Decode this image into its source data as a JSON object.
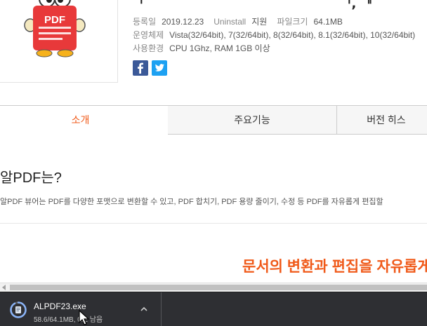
{
  "header": {
    "title_fragment_left": "ᅵ",
    "title_fragment_right": "ᅵ, ᅵᅵ"
  },
  "logo": {
    "text": "PDF"
  },
  "info": {
    "date_key": "등록일",
    "date_value": "2019.12.23",
    "uninstall_key": "Uninstall",
    "uninstall_value": "지원",
    "size_key": "파일크기",
    "size_value": "64.1MB",
    "os_key": "운영체제",
    "os_value": "Vista(32/64bit), 7(32/64bit), 8(32/64bit), 8.1(32/64bit), 10(32/64bit)",
    "env_key": "사용환경",
    "env_value": "CPU 1Ghz, RAM 1GB 이상"
  },
  "social": {
    "facebook_icon": "facebook-icon",
    "twitter_icon": "twitter-icon"
  },
  "tabs": [
    {
      "label": "소개",
      "active": true
    },
    {
      "label": "주요기능",
      "active": false
    },
    {
      "label": "버전 히스",
      "active": false
    }
  ],
  "section": {
    "heading": "알PDF는?",
    "description": "알PDF 뷰어는 PDF를 다양한 포맷으로 변환할 수 있고, PDF 합치기, PDF 용량 줄이기, 수정 등 PDF를 자유롭게 편집할"
  },
  "banner": {
    "text": "문서의 변환과 편집을 자유롭게"
  },
  "download_bar": {
    "file_name": "ALPDF23.exe",
    "status": "58.6/64.1MB, 0초 남음",
    "progress_fraction": 0.914
  },
  "colors": {
    "accent": "#f05a1a",
    "download_bar_bg": "#2e2f33",
    "facebook": "#3b5998",
    "twitter": "#1da1f2"
  }
}
